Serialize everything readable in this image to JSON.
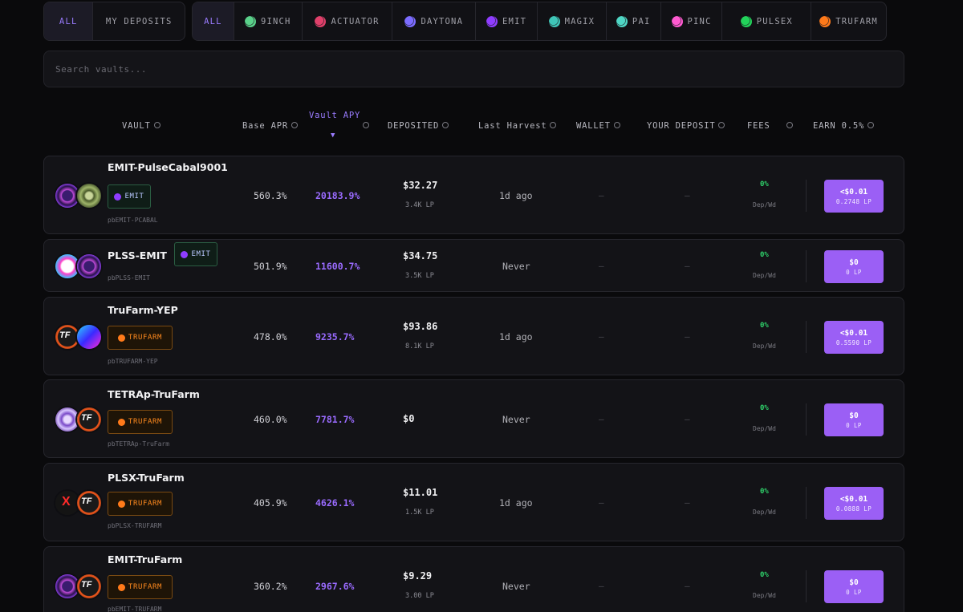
{
  "filters": {
    "ownership": [
      "ALL",
      "MY DEPOSITS"
    ],
    "platforms": [
      {
        "label": "ALL",
        "icon": null,
        "color": null
      },
      {
        "label": "9INCH",
        "icon": "9inch-logo-icon",
        "color": "#5ad18a"
      },
      {
        "label": "ACTUATOR",
        "icon": "actuator-logo-icon",
        "color": "#e0406a"
      },
      {
        "label": "DAYTONA",
        "icon": "daytona-logo-icon",
        "color": "#7b6cff"
      },
      {
        "label": "EMIT",
        "icon": "emit-logo-icon",
        "color": "#8f3dff"
      },
      {
        "label": "MAGIX",
        "icon": "magix-logo-icon",
        "color": "#3fc6b8"
      },
      {
        "label": "PAI",
        "icon": "pai-logo-icon",
        "color": "#4fd6c4"
      },
      {
        "label": "PINC",
        "icon": "pinc-logo-icon",
        "color": "#ff5ad0"
      },
      {
        "label": "PULSEX",
        "icon": "pulsex-logo-icon",
        "color": "#22d35a"
      },
      {
        "label": "TRUFARM",
        "icon": "trufarm-logo-icon",
        "color": "#ff7a1a"
      }
    ]
  },
  "search": {
    "placeholder": "Search vaults..."
  },
  "columns": {
    "vault": "VAULT",
    "base_apr": "Base APR",
    "vault_apy": "Vault APY",
    "sort_arrow": "▼",
    "deposited": "DEPOSITED",
    "last_harvest": "Last Harvest",
    "wallet": "WALLET",
    "your_deposit": "YOUR DEPOSIT",
    "fees": "FEES",
    "earn": "EARN 0.5%"
  },
  "vaults": [
    {
      "name": "EMIT-PulseCabal9001",
      "platform": "EMIT",
      "token": "pbEMIT-PCABAL",
      "base_apr": "560.3%",
      "vault_apy": "20183.9%",
      "deposited": "$32.27",
      "deposited_lp": "3.4K LP",
      "last_harvest": "1d ago",
      "wallet": "—",
      "your_deposit": "—",
      "fees": "0%",
      "fees_sub": "Dep/Wd",
      "earn_amount": "<$0.01",
      "earn_lp": "0.2748 LP",
      "icons": [
        "emit-token-icon",
        "pulsecabal-token-icon"
      ]
    },
    {
      "name": "PLSS-EMIT",
      "platform": "EMIT",
      "token": "pbPLSS-EMIT",
      "base_apr": "501.9%",
      "vault_apy": "11600.7%",
      "deposited": "$34.75",
      "deposited_lp": "3.5K LP",
      "last_harvest": "Never",
      "wallet": "—",
      "your_deposit": "—",
      "fees": "0%",
      "fees_sub": "Dep/Wd",
      "earn_amount": "$0",
      "earn_lp": "0 LP",
      "icons": [
        "plss-token-icon",
        "emit-token-icon"
      ]
    },
    {
      "name": "TruFarm-YEP",
      "platform": "TRUFARM",
      "token": "pbTRUFARM-YEP",
      "base_apr": "478.0%",
      "vault_apy": "9235.7%",
      "deposited": "$93.86",
      "deposited_lp": "8.1K LP",
      "last_harvest": "1d ago",
      "wallet": "—",
      "your_deposit": "—",
      "fees": "0%",
      "fees_sub": "Dep/Wd",
      "earn_amount": "<$0.01",
      "earn_lp": "0.5590 LP",
      "icons": [
        "trufarm-token-icon",
        "yep-token-icon"
      ]
    },
    {
      "name": "TETRAp-TruFarm",
      "platform": "TRUFARM",
      "token": "pbTETRAp-TruFarm",
      "base_apr": "460.0%",
      "vault_apy": "7781.7%",
      "deposited": "$0",
      "deposited_lp": "",
      "last_harvest": "Never",
      "wallet": "—",
      "your_deposit": "—",
      "fees": "0%",
      "fees_sub": "Dep/Wd",
      "earn_amount": "$0",
      "earn_lp": "0 LP",
      "icons": [
        "tetrap-token-icon",
        "trufarm-token-icon"
      ]
    },
    {
      "name": "PLSX-TruFarm",
      "platform": "TRUFARM",
      "token": "pbPLSX-TRUFARM",
      "base_apr": "405.9%",
      "vault_apy": "4626.1%",
      "deposited": "$11.01",
      "deposited_lp": "1.5K LP",
      "last_harvest": "1d ago",
      "wallet": "—",
      "your_deposit": "—",
      "fees": "0%",
      "fees_sub": "Dep/Wd",
      "earn_amount": "<$0.01",
      "earn_lp": "0.0888 LP",
      "icons": [
        "plsx-token-icon",
        "trufarm-token-icon"
      ]
    },
    {
      "name": "EMIT-TruFarm",
      "platform": "TRUFARM",
      "token": "pbEMIT-TRUFARM",
      "base_apr": "360.2%",
      "vault_apy": "2967.6%",
      "deposited": "$9.29",
      "deposited_lp": "3.00 LP",
      "last_harvest": "Never",
      "wallet": "—",
      "your_deposit": "—",
      "fees": "0%",
      "fees_sub": "Dep/Wd",
      "earn_amount": "$0",
      "earn_lp": "0 LP",
      "icons": [
        "emit-token-icon",
        "trufarm-token-icon"
      ]
    }
  ],
  "colors": {
    "accent": "#9a7cff",
    "earn_button": "#9b5ff5",
    "fee_green": "#2fd36b",
    "background": "#0a0a0c"
  }
}
